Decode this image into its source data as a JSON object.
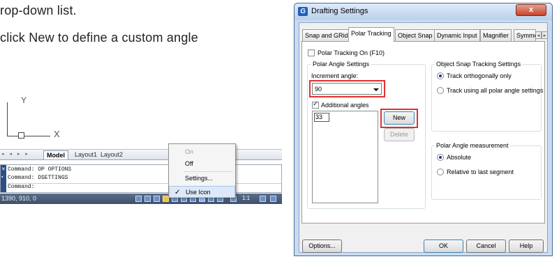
{
  "document": {
    "line1": "rop-down list.",
    "line2": "click New to define a custom angle"
  },
  "cad": {
    "axis_y": "Y",
    "axis_x": "X",
    "tab_nav": "◂ ◂ ▸ ▸",
    "tabs": [
      "Model",
      "Layout1",
      "Layout2"
    ],
    "command_lines": [
      "Command: OP OPTIONS",
      "Command: DSETTINGS",
      "Command:"
    ],
    "coordinates": "1390, 910, 0",
    "scale_label": "1:1"
  },
  "context_menu": {
    "items": [
      "On",
      "Off",
      "Settings...",
      "Use Icon"
    ],
    "checked_item": "Use Icon"
  },
  "dialog": {
    "title": "Drafting Settings",
    "title_icon": "G",
    "close_label": "x",
    "tabs": [
      "Snap and GRid",
      "Polar Tracking",
      "Object Snap",
      "Dynamic Input",
      "Magnifier",
      "Symmetr"
    ],
    "active_tab": "Polar Tracking",
    "polar_tracking_on": "Polar Tracking On (F10)",
    "polar_angle_settings": {
      "title": "Polar Angle Settings",
      "increment_label": "Increment angle:",
      "increment_value": "90",
      "additional_angles_label": "Additional angles",
      "additional_angle_value": "33",
      "new_button": "New",
      "delete_button": "Delete"
    },
    "object_snap_tracking": {
      "title": "Object Snap Tracking Settings",
      "option1": "Track orthogonally only",
      "option2": "Track using all polar angle settings"
    },
    "polar_measurement": {
      "title": "Polar Angle measurement",
      "option1": "Absolute",
      "option2": "Relative to last segment"
    },
    "buttons": {
      "options": "Options...",
      "ok": "OK",
      "cancel": "Cancel",
      "help": "Help"
    }
  }
}
